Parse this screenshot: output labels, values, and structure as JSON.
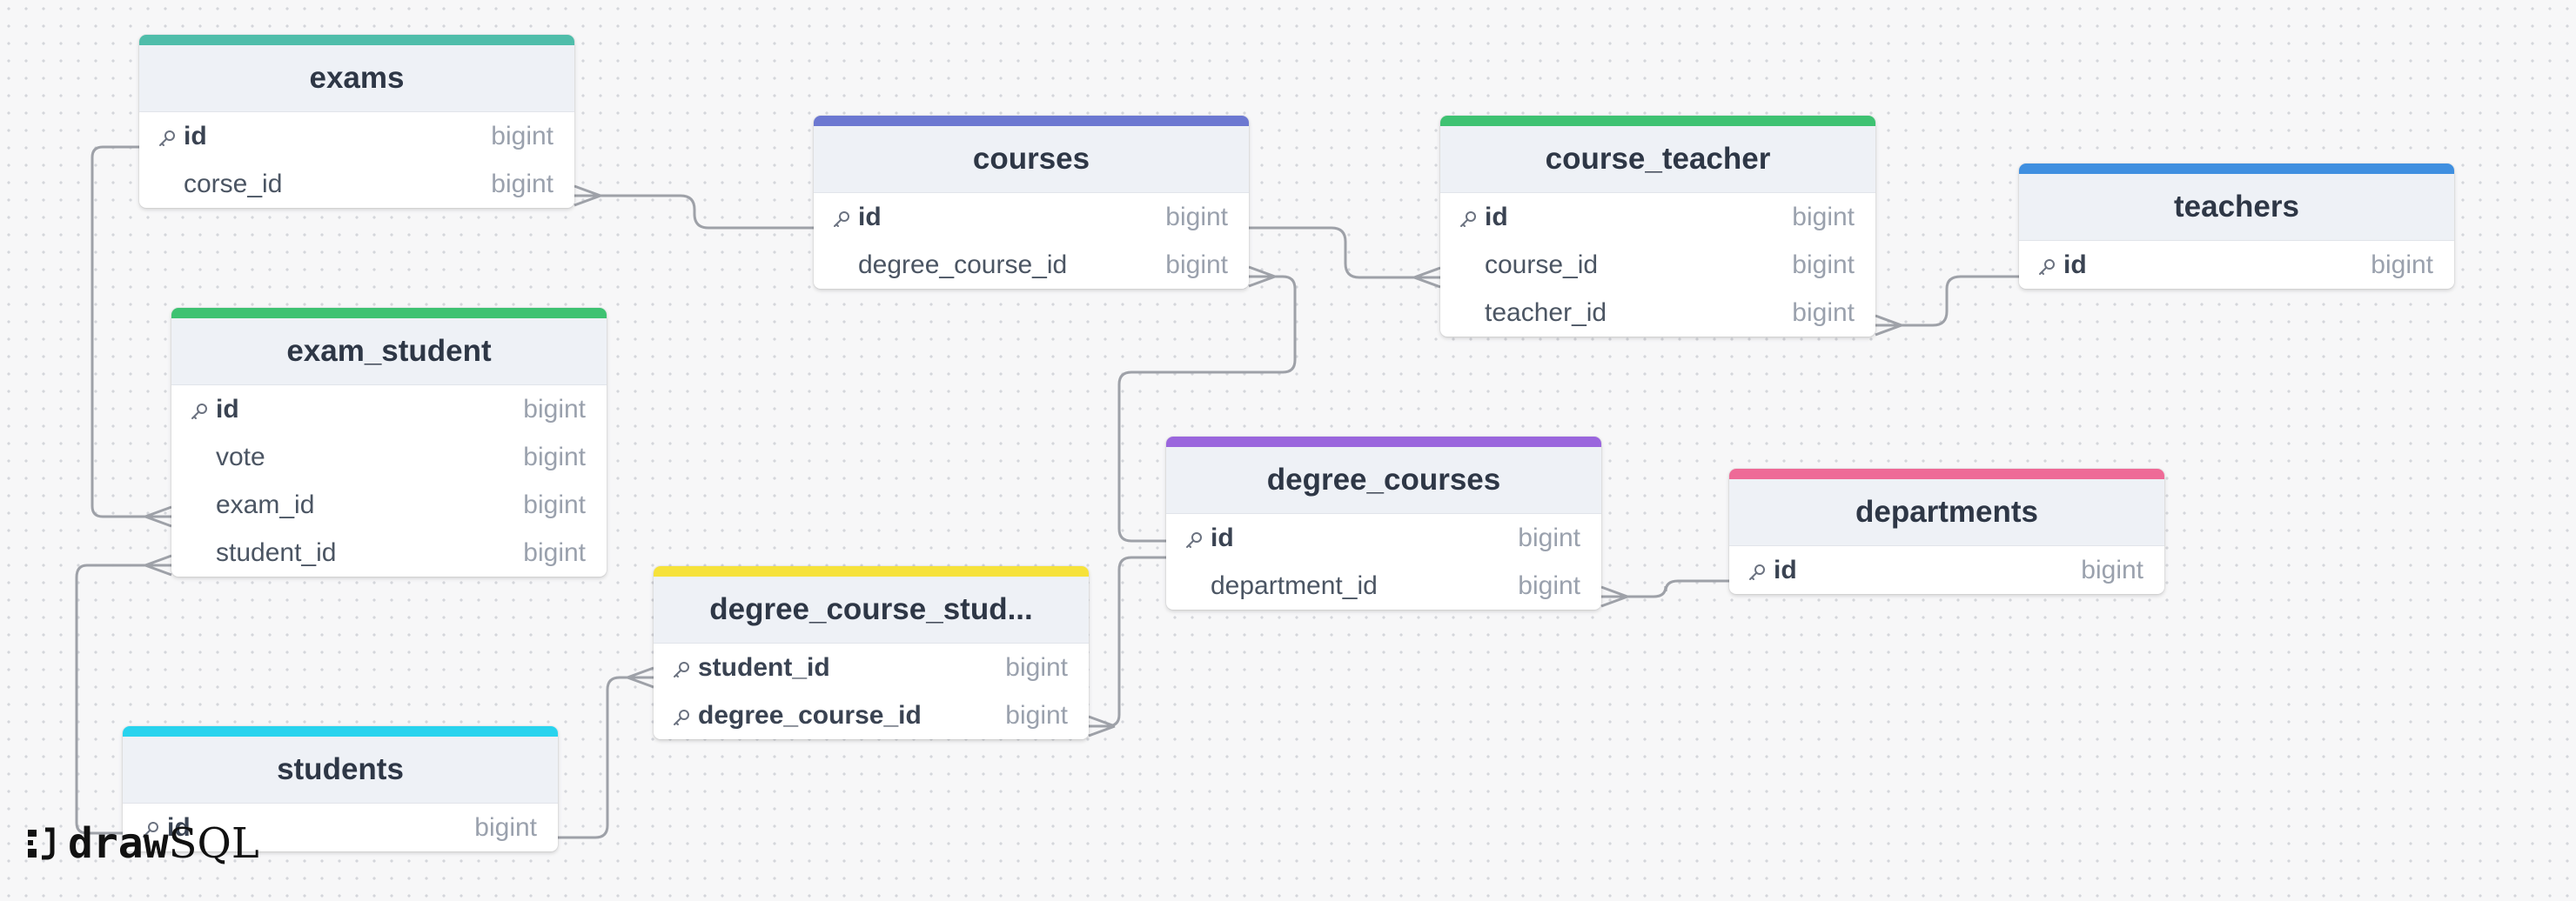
{
  "brand": {
    "part1": "draw",
    "part2": "SQL"
  },
  "tables": [
    {
      "name": "exams",
      "color": "#4fbdaa",
      "columns": [
        {
          "name": "id",
          "type": "bigint",
          "pk": true
        },
        {
          "name": "corse_id",
          "type": "bigint",
          "pk": false
        }
      ]
    },
    {
      "name": "courses",
      "color": "#6c78d1",
      "columns": [
        {
          "name": "id",
          "type": "bigint",
          "pk": true
        },
        {
          "name": "degree_course_id",
          "type": "bigint",
          "pk": false
        }
      ]
    },
    {
      "name": "course_teacher",
      "color": "#3ec272",
      "columns": [
        {
          "name": "id",
          "type": "bigint",
          "pk": true
        },
        {
          "name": "course_id",
          "type": "bigint",
          "pk": false
        },
        {
          "name": "teacher_id",
          "type": "bigint",
          "pk": false
        }
      ]
    },
    {
      "name": "teachers",
      "color": "#3f8fe0",
      "columns": [
        {
          "name": "id",
          "type": "bigint",
          "pk": true
        }
      ]
    },
    {
      "name": "exam_student",
      "color": "#3ec272",
      "columns": [
        {
          "name": "id",
          "type": "bigint",
          "pk": true
        },
        {
          "name": "vote",
          "type": "bigint",
          "pk": false
        },
        {
          "name": "exam_id",
          "type": "bigint",
          "pk": false
        },
        {
          "name": "student_id",
          "type": "bigint",
          "pk": false
        }
      ]
    },
    {
      "name": "degree_courses",
      "color": "#9a66dd",
      "columns": [
        {
          "name": "id",
          "type": "bigint",
          "pk": true
        },
        {
          "name": "department_id",
          "type": "bigint",
          "pk": false
        }
      ]
    },
    {
      "name": "departments",
      "color": "#ee6a97",
      "columns": [
        {
          "name": "id",
          "type": "bigint",
          "pk": true
        }
      ]
    },
    {
      "name": "degree_course_stud...",
      "color": "#f6e23a",
      "columns": [
        {
          "name": "student_id",
          "type": "bigint",
          "pk": true
        },
        {
          "name": "degree_course_id",
          "type": "bigint",
          "pk": true
        }
      ]
    },
    {
      "name": "students",
      "color": "#28d3ee",
      "columns": [
        {
          "name": "id",
          "type": "bigint",
          "pk": true
        }
      ]
    }
  ]
}
